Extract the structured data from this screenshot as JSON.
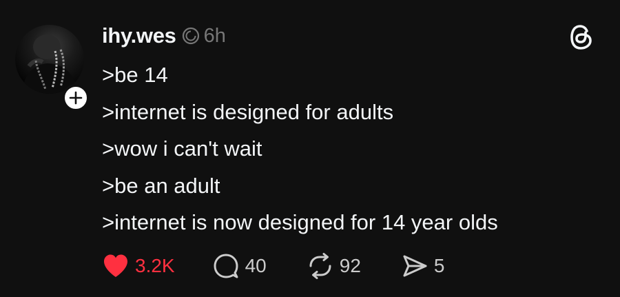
{
  "post": {
    "username": "ihy.wes",
    "timestamp": "6h",
    "lines": [
      ">be 14",
      ">internet is designed for adults",
      ">wow i can't wait",
      ">be an adult",
      ">internet is now designed for 14 year olds"
    ],
    "actions": {
      "likes": "3.2K",
      "replies": "40",
      "reposts": "92",
      "shares": "5"
    }
  },
  "icons": {
    "avatar": "profile-photo",
    "follow": "plus-icon",
    "verified": "threads-verified-icon",
    "logo": "threads-logo-icon",
    "like": "heart-icon",
    "reply": "speech-bubble-icon",
    "repost": "repost-icon",
    "share": "send-icon"
  },
  "colors": {
    "background": "#101010",
    "text": "#f3f5f7",
    "muted": "#777777",
    "like_active": "#ff3040"
  }
}
